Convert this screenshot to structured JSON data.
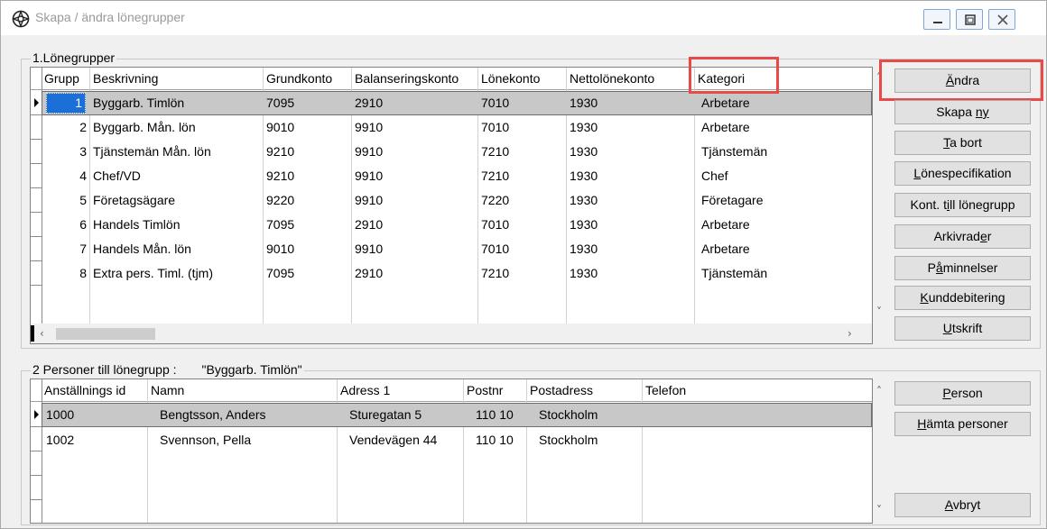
{
  "window": {
    "title": "Skapa / ändra lönegrupper"
  },
  "top_group": {
    "legend": "1.Lönegrupper",
    "columns": [
      "Grupp",
      "Beskrivning",
      "Grundkonto",
      "Balanseringskonto",
      "Lönekonto",
      "Nettolönekonto",
      "Kategori"
    ],
    "rows": [
      {
        "grupp": "1",
        "beskrivning": "Byggarb. Timlön",
        "grundkonto": "7095",
        "balans": "2910",
        "lonekonto": "7010",
        "netto": "1930",
        "kategori": "Arbetare"
      },
      {
        "grupp": "2",
        "beskrivning": "Byggarb. Mån. lön",
        "grundkonto": "9010",
        "balans": "9910",
        "lonekonto": "7010",
        "netto": "1930",
        "kategori": "Arbetare"
      },
      {
        "grupp": "3",
        "beskrivning": "Tjänstemän Mån. lön",
        "grundkonto": "9210",
        "balans": "9910",
        "lonekonto": "7210",
        "netto": "1930",
        "kategori": "Tjänstemän"
      },
      {
        "grupp": "4",
        "beskrivning": "Chef/VD",
        "grundkonto": "9210",
        "balans": "9910",
        "lonekonto": "7210",
        "netto": "1930",
        "kategori": "Chef"
      },
      {
        "grupp": "5",
        "beskrivning": "Företagsägare",
        "grundkonto": "9220",
        "balans": "9910",
        "lonekonto": "7220",
        "netto": "1930",
        "kategori": "Företagare"
      },
      {
        "grupp": "6",
        "beskrivning": "Handels Timlön",
        "grundkonto": "7095",
        "balans": "2910",
        "lonekonto": "7010",
        "netto": "1930",
        "kategori": "Arbetare"
      },
      {
        "grupp": "7",
        "beskrivning": "Handels Mån. lön",
        "grundkonto": "9010",
        "balans": "9910",
        "lonekonto": "7010",
        "netto": "1930",
        "kategori": "Arbetare"
      },
      {
        "grupp": "8",
        "beskrivning": "Extra pers. Timl. (tjm)",
        "grundkonto": "7095",
        "balans": "2910",
        "lonekonto": "7210",
        "netto": "1930",
        "kategori": "Tjänstemän"
      }
    ]
  },
  "top_buttons": [
    {
      "pre": "",
      "u": "Ä",
      "post": "ndra"
    },
    {
      "pre": "Skapa ",
      "u": "ny",
      "post": ""
    },
    {
      "pre": "",
      "u": "T",
      "post": "a bort"
    },
    {
      "pre": "",
      "u": "L",
      "post": "önespecifikation"
    },
    {
      "pre": "Kont. t",
      "u": "i",
      "post": "ll lönegrupp"
    },
    {
      "pre": "Arkivrad",
      "u": "e",
      "post": "r"
    },
    {
      "pre": "P",
      "u": "å",
      "post": "minnelser"
    },
    {
      "pre": "",
      "u": "K",
      "post": "unddebitering"
    },
    {
      "pre": "",
      "u": "U",
      "post": "tskrift"
    }
  ],
  "bottom_group": {
    "legend_prefix": "2 Personer till lönegrupp :",
    "legend_group": "\"Byggarb. Timlön\"",
    "columns": [
      "Anställnings id",
      "Namn",
      "Adress 1",
      "Postnr",
      "Postadress",
      "Telefon"
    ],
    "rows": [
      {
        "id": "1000",
        "namn": "Bengtsson, Anders",
        "adress": "Sturegatan 5",
        "postnr": "110 10",
        "postadress": "Stockholm",
        "telefon": ""
      },
      {
        "id": "1002",
        "namn": "Svennson, Pella",
        "adress": "Vendevägen 44",
        "postnr": "110 10",
        "postadress": "Stockholm",
        "telefon": ""
      }
    ]
  },
  "bottom_buttons": [
    {
      "pre": "",
      "u": "P",
      "post": "erson"
    },
    {
      "pre": "",
      "u": "H",
      "post": "ämta personer"
    },
    {
      "pre": "",
      "u": "A",
      "post": "vbryt"
    }
  ],
  "colors": {
    "highlight": "#e84a4a",
    "selection": "#c8c8c8",
    "focus": "#1c6fd6"
  }
}
